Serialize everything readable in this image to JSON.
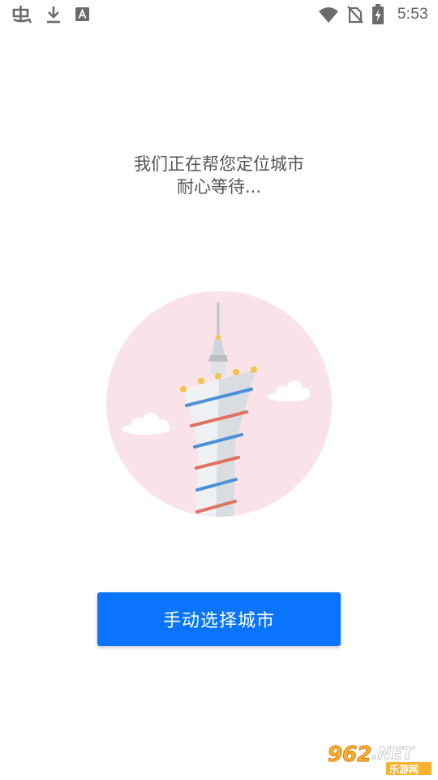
{
  "status_bar": {
    "time": "5:53",
    "left_icons": [
      "bug-icon",
      "download-icon",
      "font-app-icon"
    ],
    "right_icons": [
      "wifi-icon",
      "no-sim-icon",
      "battery-charging-icon"
    ]
  },
  "message": {
    "line1": "我们正在帮您定位城市",
    "line2": "耐心等待..."
  },
  "illustration": {
    "circle_color": "#f9e3e8",
    "stripe_blue": "#4a90d9",
    "stripe_red": "#e07060"
  },
  "button": {
    "label": "手动选择城市",
    "color": "#0a74ff"
  },
  "watermark": {
    "number": "962",
    "suffix": ".NET",
    "subtitle": "乐游网"
  }
}
